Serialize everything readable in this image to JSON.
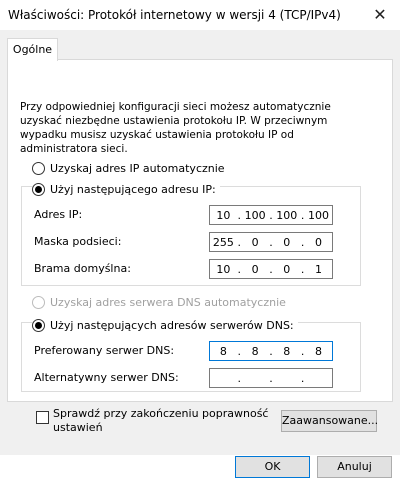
{
  "window": {
    "title": "Właściwości: Protokół internetowy w wersji 4 (TCP/IPv4)",
    "close_glyph": "✕"
  },
  "tabs": [
    {
      "label": "Ogólne"
    }
  ],
  "general": {
    "description": "Przy odpowiedniej konfiguracji sieci możesz automatycznie uzyskać niezbędne ustawienia protokołu IP. W przeciwnym wypadku musisz uzyskać ustawienia protokołu IP od administratora sieci.",
    "ip_auto_label": "Uzyskaj adres IP automatycznie",
    "ip_manual_label": "Użyj następującego adresu IP:",
    "ip_address_label": "Adres IP:",
    "subnet_label": "Maska podsieci:",
    "gateway_label": "Brama domyślna:",
    "ip_address": [
      "10",
      "100",
      "100",
      "100"
    ],
    "subnet": [
      "255",
      "0",
      "0",
      "0"
    ],
    "gateway": [
      "10",
      "0",
      "0",
      "1"
    ],
    "dns_auto_label": "Uzyskaj adres serwera DNS automatycznie",
    "dns_manual_label": "Użyj następujących adresów serwerów DNS:",
    "preferred_dns_label": "Preferowany serwer DNS:",
    "alternate_dns_label": "Alternatywny serwer DNS:",
    "preferred_dns": [
      "8",
      "8",
      "8",
      "8"
    ],
    "alternate_dns": [
      "",
      "",
      "",
      ""
    ],
    "validate_label_line1": "Sprawdź przy zakończeniu poprawność",
    "validate_label_line2": "ustawień",
    "advanced_button": "Zaawansowane..."
  },
  "footer": {
    "ok": "OK",
    "cancel": "Anuluj"
  },
  "state": {
    "ip_mode": "manual",
    "dns_mode": "manual",
    "validate_checked": false
  }
}
